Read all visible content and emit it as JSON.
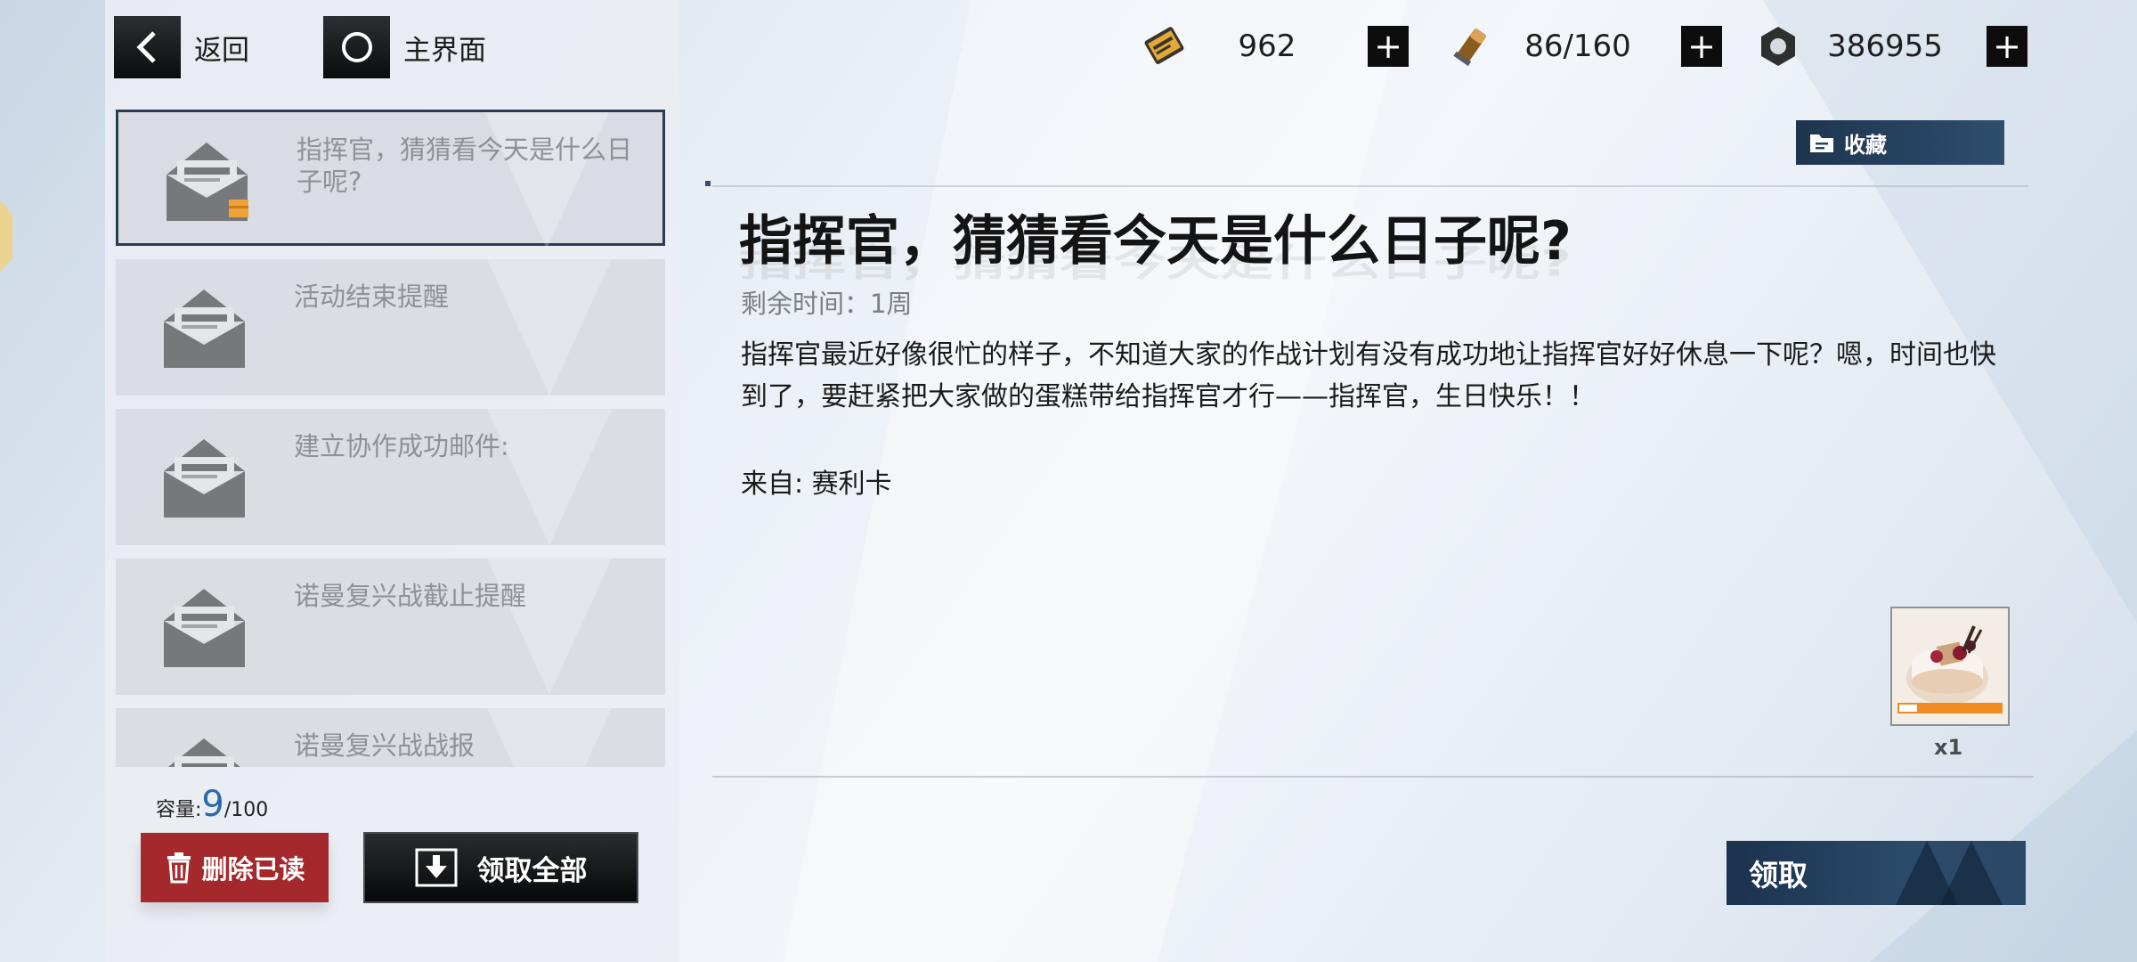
{
  "nav": {
    "back_label": "返回",
    "home_label": "主界面"
  },
  "resources": [
    {
      "icon": "battery-ticket-icon",
      "value": "962"
    },
    {
      "icon": "ammo-icon",
      "value": "86/160"
    },
    {
      "icon": "gear-nut-icon",
      "value": "386955"
    }
  ],
  "mail_list": [
    {
      "title": "指挥官，猜猜看今天是什么日子呢?",
      "selected": true,
      "has_attachment": true
    },
    {
      "title": "活动结束提醒",
      "selected": false,
      "has_attachment": false
    },
    {
      "title": "建立协作成功邮件:",
      "selected": false,
      "has_attachment": false
    },
    {
      "title": "诺曼复兴战截止提醒",
      "selected": false,
      "has_attachment": false
    },
    {
      "title": "诺曼复兴战战报",
      "selected": false,
      "has_attachment": false
    }
  ],
  "capacity": {
    "label": "容量:",
    "current": "9",
    "max": "/100"
  },
  "buttons": {
    "delete_read": "删除已读",
    "claim_all": "领取全部",
    "favorite": "收藏",
    "claim": "领取"
  },
  "detail": {
    "title": "指挥官，猜猜看今天是什么日子呢?",
    "remaining": "剩余时间：1周",
    "body": "指挥官最近好像很忙的样子，不知道大家的作战计划有没有成功地让指挥官好好休息一下呢？嗯，时间也快到了，要赶紧把大家做的蛋糕带给指挥官才行——指挥官，生日快乐！！",
    "sender": "来自: 赛利卡",
    "reward": {
      "icon": "birthday-cake-supply-icon",
      "tag": "SUPPLY",
      "quantity": "x1"
    }
  },
  "colors": {
    "delete": "#a5282c",
    "accent_blue": "#2b6aa8",
    "navy": "#1e3550"
  }
}
